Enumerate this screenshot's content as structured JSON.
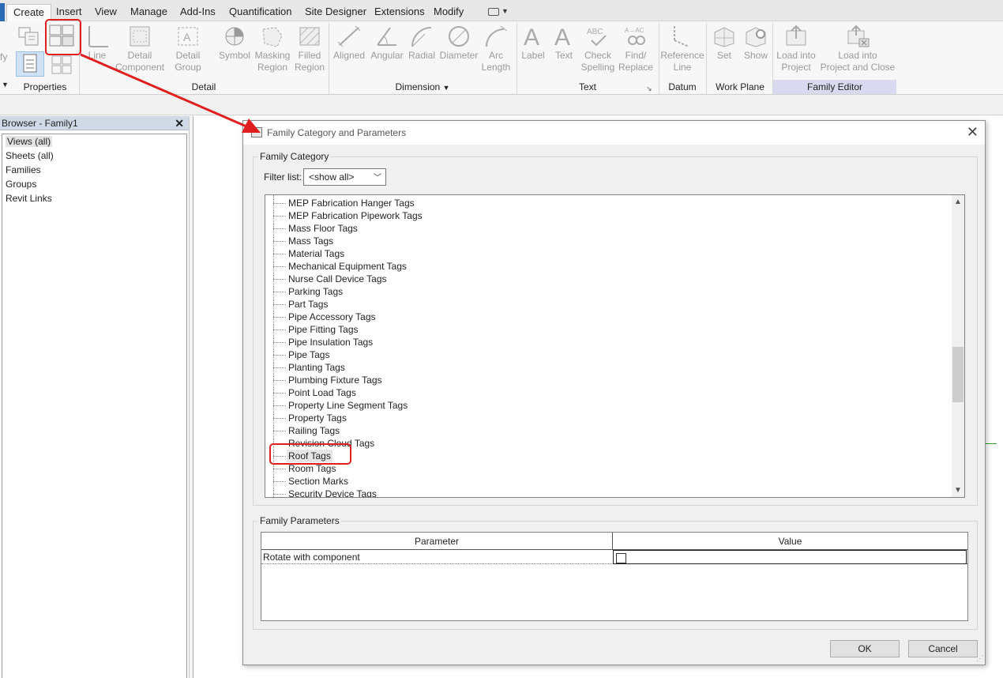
{
  "ribbon_tabs": [
    "Create",
    "Insert",
    "View",
    "Manage",
    "Add-Ins",
    "Quantification",
    "Site Designer",
    "Extensions",
    "Modify"
  ],
  "ribbon": {
    "left_stub": "fy",
    "buttons": {
      "line": [
        "Line",
        ""
      ],
      "detail_component": [
        "Detail",
        "Component"
      ],
      "detail_group": [
        "Detail",
        "Group"
      ],
      "symbol": [
        "Symbol",
        ""
      ],
      "masking_region": [
        "Masking",
        "Region"
      ],
      "filled_region": [
        "Filled",
        "Region"
      ],
      "aligned": [
        "Aligned",
        ""
      ],
      "angular": [
        "Angular",
        ""
      ],
      "radial": [
        "Radial",
        ""
      ],
      "diameter": [
        "Diameter",
        ""
      ],
      "arc_length": [
        "Arc",
        "Length"
      ],
      "label": [
        "Label",
        ""
      ],
      "text": [
        "Text",
        ""
      ],
      "check_spelling": [
        "Check",
        "Spelling"
      ],
      "find_replace": [
        "Find/",
        "Replace"
      ],
      "reference_line": [
        "Reference",
        "Line"
      ],
      "set": [
        "Set",
        ""
      ],
      "show": [
        "Show",
        ""
      ],
      "load_into_project": [
        "Load into",
        "Project"
      ],
      "load_into_project_close": [
        "Load into",
        "Project and Close"
      ]
    },
    "panels": {
      "properties": "Properties",
      "detail": "Detail",
      "dimension": "Dimension",
      "text": "Text",
      "datum": "Datum",
      "work_plane": "Work Plane",
      "family_editor": "Family Editor"
    }
  },
  "browser": {
    "title": "Browser - Family1",
    "items": [
      "Views (all)",
      "Sheets (all)",
      "Families",
      "Groups",
      "Revit Links"
    ]
  },
  "dialog": {
    "title": "Family Category and Parameters",
    "category_group": "Family Category",
    "filter_label": "Filter list:",
    "filter_value": "<show all>",
    "categories": [
      "MEP Fabrication Hanger Tags",
      "MEP Fabrication Pipework Tags",
      "Mass Floor Tags",
      "Mass Tags",
      "Material Tags",
      "Mechanical Equipment Tags",
      "Nurse Call Device Tags",
      "Parking Tags",
      "Part Tags",
      "Pipe Accessory Tags",
      "Pipe Fitting Tags",
      "Pipe Insulation Tags",
      "Pipe Tags",
      "Planting Tags",
      "Plumbing Fixture Tags",
      "Point Load Tags",
      "Property Line Segment Tags",
      "Property Tags",
      "Railing Tags",
      "Revision Cloud Tags",
      "Roof Tags",
      "Room Tags",
      "Section Marks",
      "Security Device Tags"
    ],
    "selected_category": "Roof Tags",
    "params_group": "Family Parameters",
    "param_header": "Parameter",
    "value_header": "Value",
    "params": [
      {
        "name": "Rotate with component",
        "checked": false
      }
    ],
    "ok": "OK",
    "cancel": "Cancel"
  },
  "colors": {
    "highlight": "#e02020",
    "family_editor_panel": "#d9d9f0",
    "browser_header": "#cfdae6"
  }
}
